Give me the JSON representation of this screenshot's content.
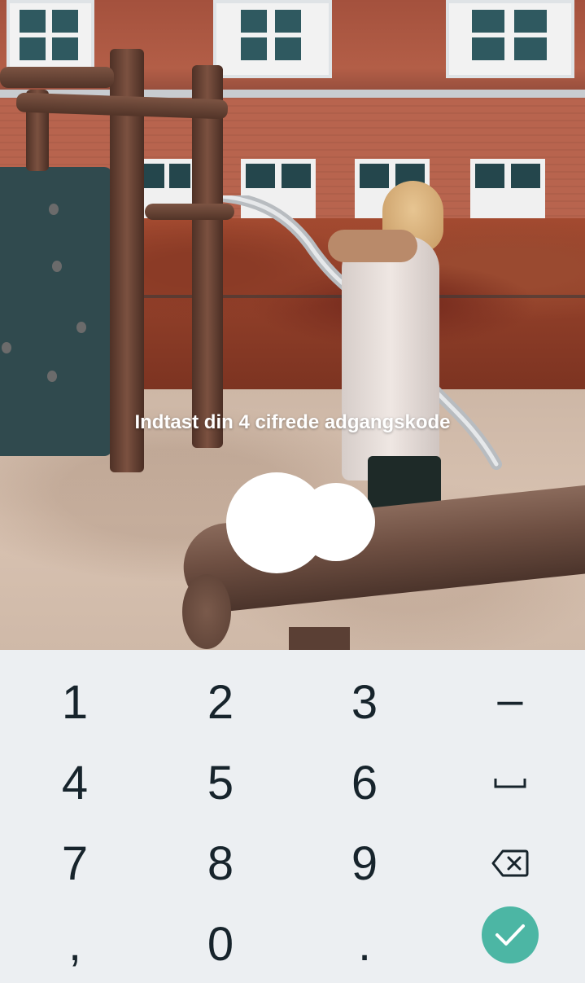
{
  "prompt": {
    "text": "Indtast din 4 cifrede adgangskode"
  },
  "pin": {
    "entered_digits": 2,
    "dot_color": "#ffffff"
  },
  "keypad": {
    "background": "#eceff2",
    "key_color": "#17242c",
    "rows": [
      [
        "1",
        "2",
        "3",
        "–"
      ],
      [
        "4",
        "5",
        "6",
        "space-key-icon"
      ],
      [
        "7",
        "8",
        "9",
        "backspace-icon"
      ],
      [
        ",",
        "0",
        ".",
        "checkmark-icon"
      ]
    ],
    "confirm": {
      "icon": "checkmark-icon",
      "color": "#4cb6a4"
    }
  }
}
